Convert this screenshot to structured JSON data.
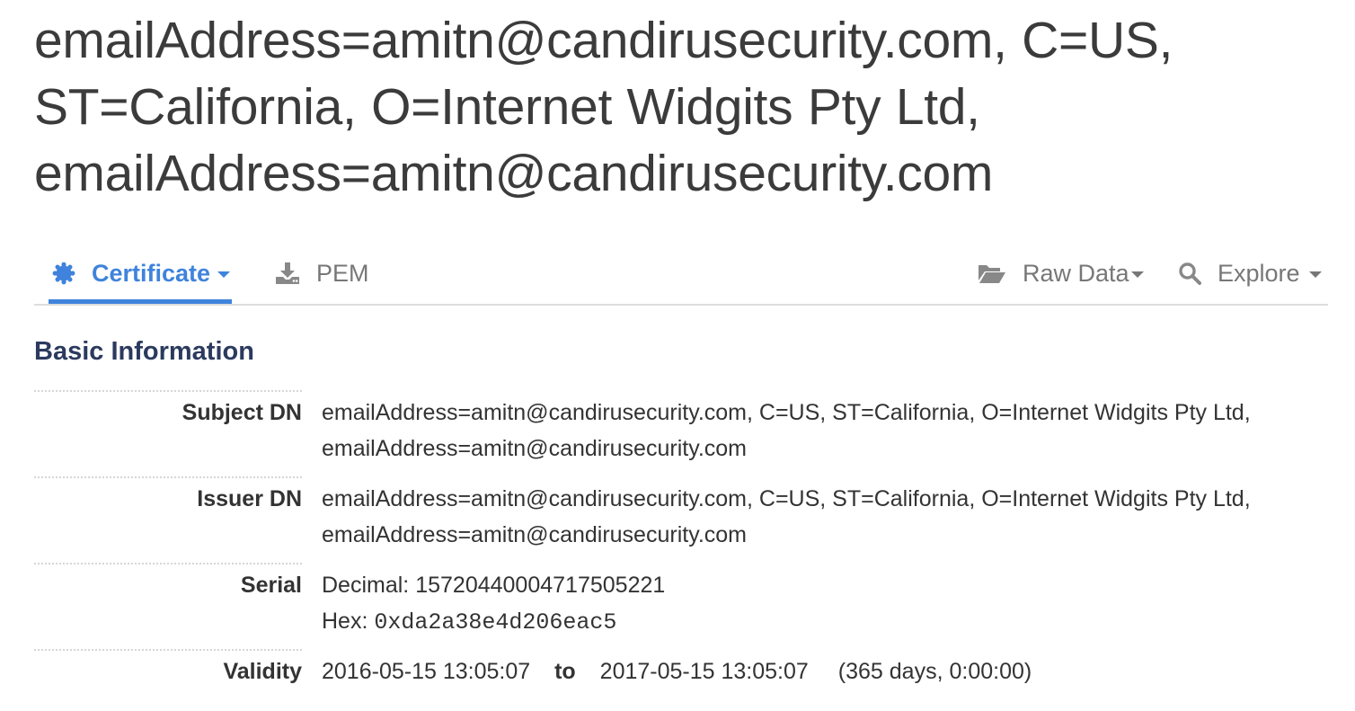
{
  "page": {
    "title": "emailAddress=amitn@candirusecurity.com, C=US, ST=California, O=Internet Widgits Pty Ltd, emailAddress=amitn@candirusecurity.com"
  },
  "tabs": {
    "certificate": {
      "label": "Certificate",
      "icon": "certificate-seal-icon"
    },
    "pem": {
      "label": "PEM",
      "icon": "download-icon"
    },
    "raw_data": {
      "label": "Raw Data",
      "icon": "folder-open-icon"
    },
    "explore": {
      "label": "Explore",
      "icon": "search-icon"
    }
  },
  "basic_info": {
    "title": "Basic Information",
    "subject_dn": {
      "label": "Subject DN",
      "value": "emailAddress=amitn@candirusecurity.com, C=US, ST=California, O=Internet Widgits Pty Ltd, emailAddress=amitn@candirusecurity.com"
    },
    "issuer_dn": {
      "label": "Issuer DN",
      "value": "emailAddress=amitn@candirusecurity.com, C=US, ST=California, O=Internet Widgits Pty Ltd, emailAddress=amitn@candirusecurity.com"
    },
    "serial": {
      "label": "Serial",
      "decimal_label": "Decimal:",
      "decimal": "15720440004717505221",
      "hex_label": "Hex:",
      "hex": "0xda2a38e4d206eac5"
    },
    "validity": {
      "label": "Validity",
      "start": "2016-05-15 13:05:07",
      "to": "to",
      "end": "2017-05-15 13:05:07",
      "duration": "(365 days, 0:00:00)"
    }
  },
  "colors": {
    "accent": "#3f83dc",
    "heading": "#2b3a5e",
    "text": "#333333",
    "muted": "#777777"
  }
}
